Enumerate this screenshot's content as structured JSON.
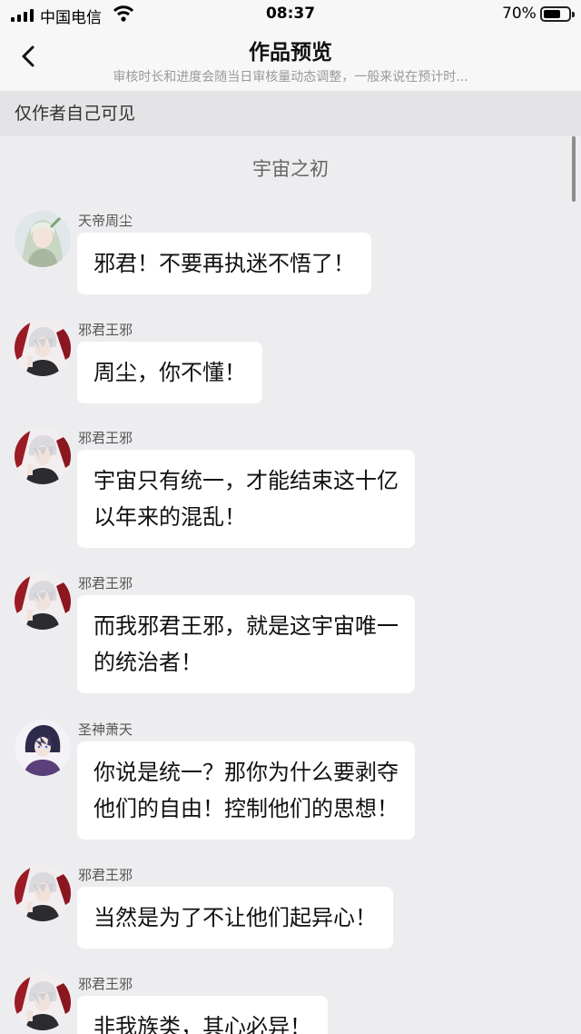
{
  "status_bar": {
    "carrier": "中国电信",
    "time": "08:37",
    "battery": "70%",
    "battery_level": 0.7
  },
  "nav": {
    "title": "作品预览",
    "subtitle": "审核时长和进度会随当日审核量动态调整，一般来说在预计时..."
  },
  "visibility_notice": "仅作者自己可见",
  "chat": {
    "title": "宇宙之初",
    "messages": [
      {
        "sender": "天帝周尘",
        "avatar": "zhouchen-avatar",
        "lines": [
          "邪君！不要再执迷不悟了！"
        ]
      },
      {
        "sender": "邪君王邪",
        "avatar": "xiejun-avatar",
        "lines": [
          "周尘，你不懂！"
        ]
      },
      {
        "sender": "邪君王邪",
        "avatar": "xiejun-avatar",
        "lines": [
          "宇宙只有统一，才能结束这十亿",
          "以年来的混乱！"
        ]
      },
      {
        "sender": "邪君王邪",
        "avatar": "xiejun-avatar",
        "lines": [
          "而我邪君王邪，就是这宇宙唯一",
          "的统治者！"
        ]
      },
      {
        "sender": "圣神萧天",
        "avatar": "xiaotian-avatar",
        "lines": [
          "你说是统一？那你为什么要剥夺",
          "他们的自由！控制他们的思想！"
        ]
      },
      {
        "sender": "邪君王邪",
        "avatar": "xiejun-avatar",
        "lines": [
          "当然是为了不让他们起异心！"
        ]
      },
      {
        "sender": "邪君王邪",
        "avatar": "xiejun-avatar",
        "lines": [
          "非我族类，其心必异！"
        ]
      }
    ]
  }
}
